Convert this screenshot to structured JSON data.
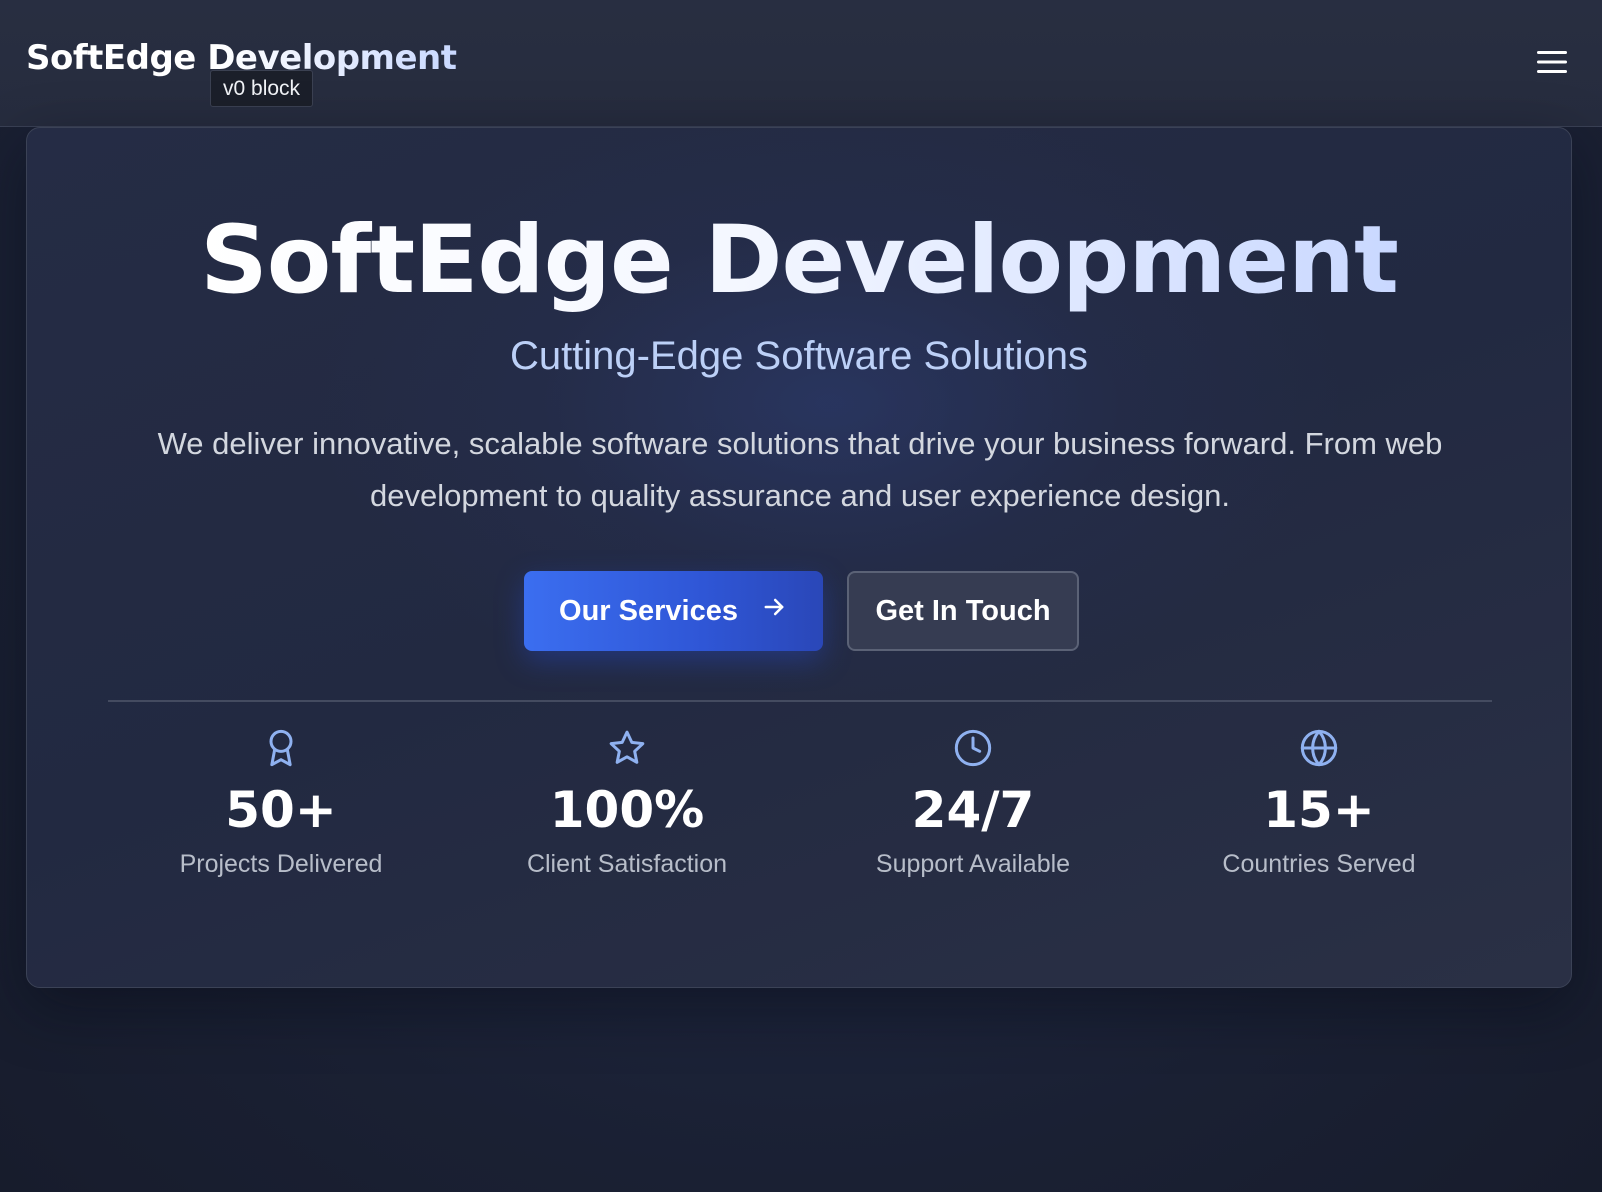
{
  "header": {
    "brand": "SoftEdge Development",
    "tooltip": "v0 block",
    "menu_icon": "hamburger-menu-icon"
  },
  "hero": {
    "title": "SoftEdge Development",
    "subtitle": "Cutting-Edge Software Solutions",
    "description": "We deliver innovative, scalable software solutions that drive your business forward. From web development to quality assurance and user experience design.",
    "primary_button": {
      "label": "Our Services",
      "icon": "arrow-right-icon"
    },
    "secondary_button": {
      "label": "Get In Touch"
    }
  },
  "stats": [
    {
      "icon": "award-icon",
      "value": "50+",
      "label": "Projects Delivered"
    },
    {
      "icon": "star-icon",
      "value": "100%",
      "label": "Client Satisfaction"
    },
    {
      "icon": "clock-icon",
      "value": "24/7",
      "label": "Support Available"
    },
    {
      "icon": "globe-icon",
      "value": "15+",
      "label": "Countries Served"
    }
  ],
  "colors": {
    "accent": "#3b6ef0",
    "icon": "#8fb1f0",
    "subtitle": "#bcd0f7"
  }
}
